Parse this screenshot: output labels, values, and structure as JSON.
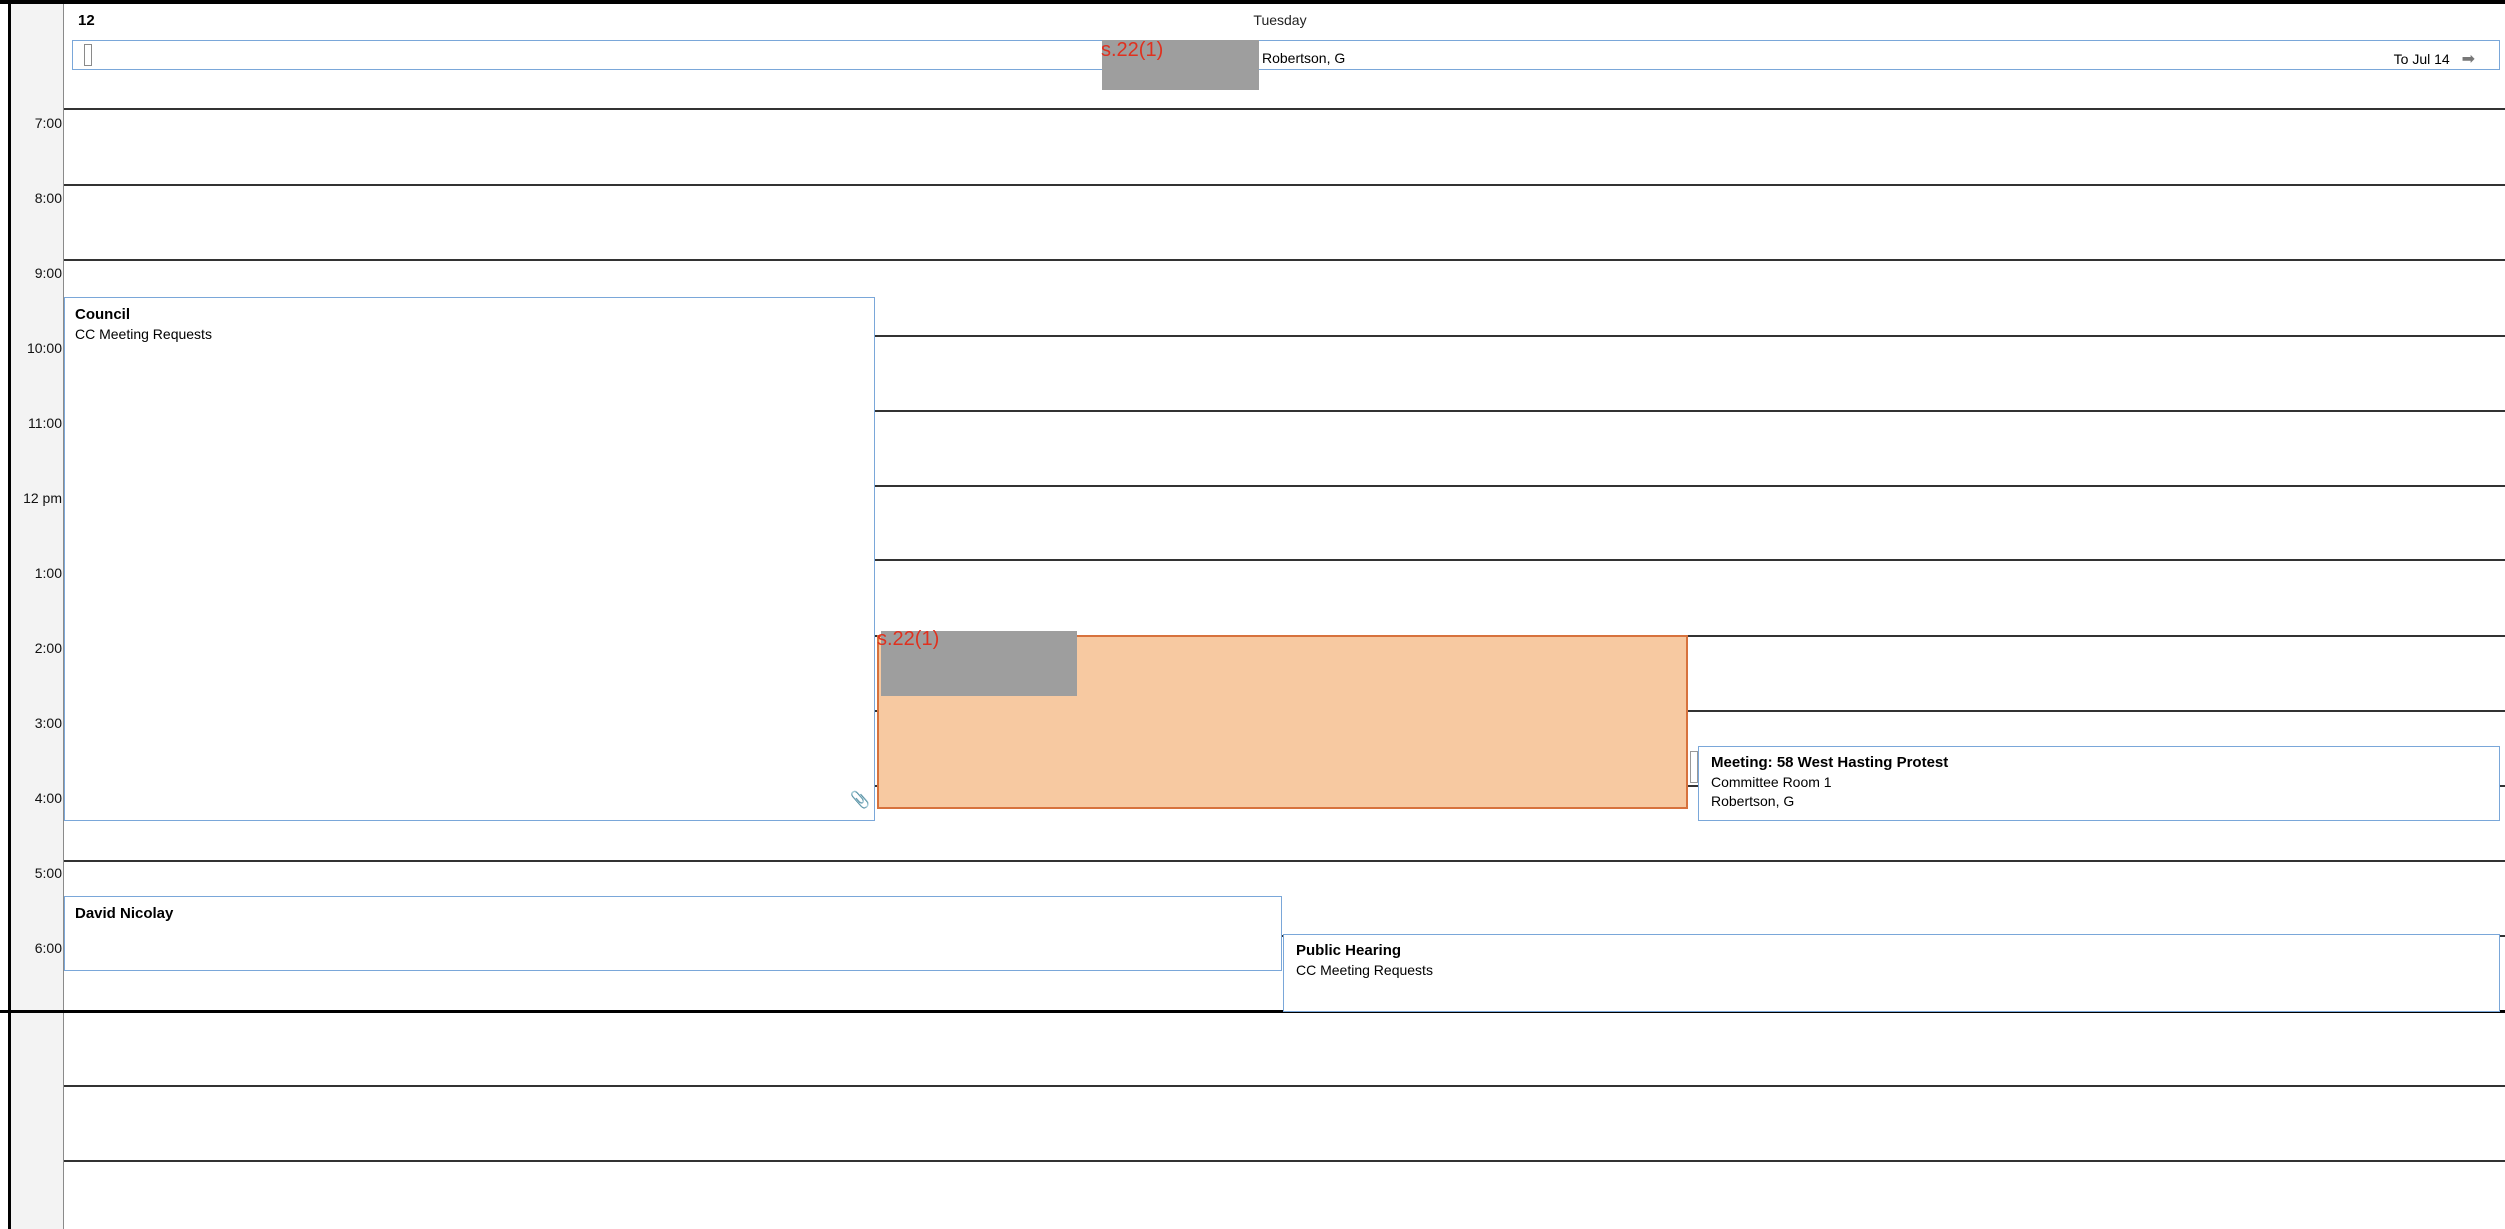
{
  "header": {
    "day_number": "12",
    "day_name": "Tuesday"
  },
  "all_day": {
    "redaction_label": "s.22(1)",
    "owner": "Robertson, G",
    "nav_label": "To Jul 14",
    "nav_icon": "arrow-right-icon"
  },
  "time_labels": [
    "7:00",
    "8:00",
    "9:00",
    "10:00",
    "11:00",
    "12 pm",
    "1:00",
    "2:00",
    "3:00",
    "4:00",
    "5:00",
    "6:00"
  ],
  "appointments": {
    "council": {
      "title": "Council",
      "line1": "CC Meeting Requests"
    },
    "redacted": {
      "label": "s.22(1)"
    },
    "meeting": {
      "title": "Meeting: 58 West Hasting Protest",
      "line1": "Committee Room 1",
      "line2": "Robertson, G"
    },
    "david": {
      "title": "David Nicolay"
    },
    "public_hearing": {
      "title": "Public Hearing",
      "line1": "CC Meeting Requests"
    }
  },
  "colors": {
    "accent_border": "#7aa7d9",
    "tentative_fill": "#f7c9a1",
    "tentative_border": "#d7723d",
    "redaction_text": "#e0301e"
  }
}
